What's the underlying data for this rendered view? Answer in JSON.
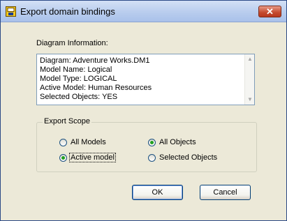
{
  "window": {
    "title": "Export domain bindings",
    "close_glyph": "✕"
  },
  "diagram_info": {
    "label": "Diagram Information:",
    "lines": [
      "Diagram:  Adventure Works.DM1",
      "Model Name:  Logical",
      "Model Type:  LOGICAL",
      "Active Model:  Human Resources",
      "Selected Objects:  YES"
    ]
  },
  "export_scope": {
    "title": "Export Scope",
    "options": {
      "all_models": {
        "label": "All Models",
        "checked": false
      },
      "active_model": {
        "label": "Active model",
        "checked": true
      },
      "all_objects": {
        "label": "All Objects",
        "checked": true
      },
      "selected_objects": {
        "label": "Selected Objects",
        "checked": false
      }
    }
  },
  "buttons": {
    "ok": "OK",
    "cancel": "Cancel"
  },
  "colors": {
    "accent_radio": "#20a020",
    "close_button": "#c44a2e"
  }
}
